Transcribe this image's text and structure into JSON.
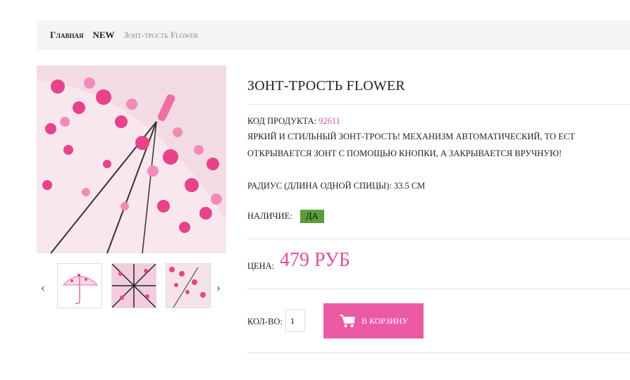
{
  "breadcrumb": {
    "home": "Главная",
    "category": "NEW",
    "current": "Зонт-трость Flower"
  },
  "product": {
    "title": "Зонт-трость Flower",
    "code_label": "Код продукта:",
    "code_value": "92611",
    "desc_line1": "Яркий и стильный зонт-трость! Механизм автоматический, то ест",
    "desc_line2": "открывается зонт с помощью кнопки, а закрывается вручную!",
    "radius": "Радиус (длина одной спицы): 33.5 см",
    "stock_label": "Наличие:",
    "stock_value": "Да",
    "price_label": "Цена:",
    "price_value": "479 руб",
    "qty_label": "Кол-во:",
    "qty_value": "1",
    "cart_label": "В корзину"
  },
  "gallery": {
    "prev": "‹",
    "next": "›"
  },
  "colors": {
    "accent": "#ec5aa4",
    "price": "#e0509a",
    "stock": "#5a9e3a"
  }
}
